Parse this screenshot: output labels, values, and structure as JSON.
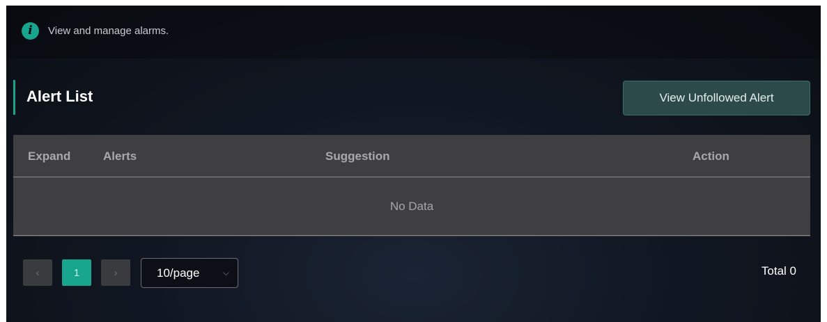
{
  "info": {
    "icon": "info-icon",
    "icon_glyph": "i",
    "text": "View and manage alarms."
  },
  "section": {
    "title": "Alert List",
    "button_label": "View Unfollowed Alert"
  },
  "table": {
    "columns": [
      "Expand",
      "Alerts",
      "Suggestion",
      "Action"
    ],
    "rows": [],
    "empty_text": "No Data"
  },
  "pagination": {
    "prev_glyph": "‹",
    "next_glyph": "›",
    "current_page": "1",
    "page_size": "10/page",
    "page_size_icon": "chevron-down-icon",
    "chevron_glyph": "⌵",
    "total": "Total 0"
  },
  "colors": {
    "accent": "#17a58d",
    "table_bg": "#3f3f42",
    "panel_bg": "#0b0e14"
  }
}
